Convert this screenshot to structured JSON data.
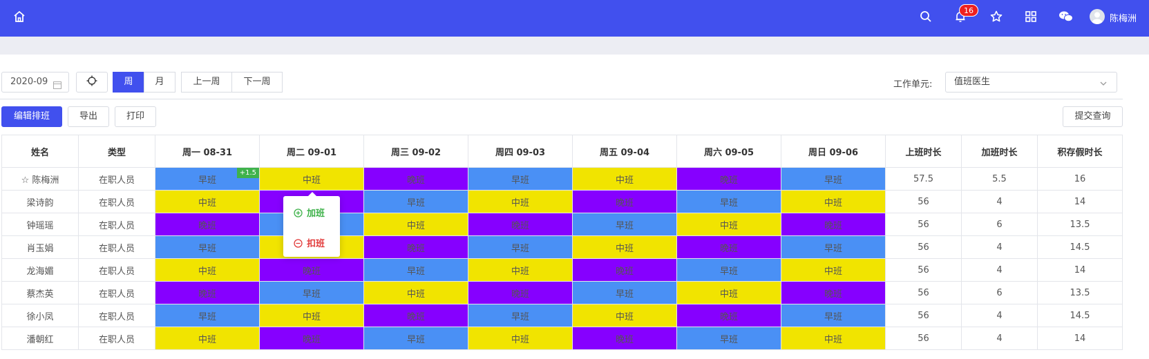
{
  "header": {
    "notifications": "16",
    "username": "陈梅洲"
  },
  "toolbar": {
    "month": "2020-09",
    "view_week": "周",
    "view_month": "月",
    "prev_week": "上一周",
    "next_week": "下一周",
    "work_unit_label": "工作单元:",
    "work_unit_value": "值班医生",
    "edit_schedule": "编辑排班",
    "export": "导出",
    "print": "打印",
    "submit_query": "提交查询"
  },
  "table": {
    "headers": [
      "姓名",
      "类型",
      "周一 08-31",
      "周二 09-01",
      "周三 09-02",
      "周四 09-03",
      "周五 09-04",
      "周六 09-05",
      "周日 09-06",
      "上班时长",
      "加班时长",
      "积存假时长"
    ],
    "rows": [
      {
        "name": "☆ 陈梅洲",
        "type": "在职人员",
        "shifts": [
          "早班",
          "中班",
          "晚班",
          "早班",
          "中班",
          "晚班",
          "早班"
        ],
        "work": "57.5",
        "overtime": "5.5",
        "leave": "16",
        "tag": "+1.5"
      },
      {
        "name": "梁诗韵",
        "type": "在职人员",
        "shifts": [
          "中班",
          "晚班",
          "早班",
          "中班",
          "晚班",
          "早班",
          "中班"
        ],
        "work": "56",
        "overtime": "4",
        "leave": "14"
      },
      {
        "name": "钟瑶瑶",
        "type": "在职人员",
        "shifts": [
          "晚班",
          "早班",
          "中班",
          "晚班",
          "早班",
          "中班",
          "晚班"
        ],
        "work": "56",
        "overtime": "6",
        "leave": "13.5"
      },
      {
        "name": "肖玉娟",
        "type": "在职人员",
        "shifts": [
          "早班",
          "中班",
          "晚班",
          "早班",
          "中班",
          "晚班",
          "早班"
        ],
        "work": "56",
        "overtime": "4",
        "leave": "14.5"
      },
      {
        "name": "龙海媚",
        "type": "在职人员",
        "shifts": [
          "中班",
          "晚班",
          "早班",
          "中班",
          "晚班",
          "早班",
          "中班"
        ],
        "work": "56",
        "overtime": "4",
        "leave": "14"
      },
      {
        "name": "蔡杰英",
        "type": "在职人员",
        "shifts": [
          "晚班",
          "早班",
          "中班",
          "晚班",
          "早班",
          "中班",
          "晚班"
        ],
        "work": "56",
        "overtime": "6",
        "leave": "13.5"
      },
      {
        "name": "徐小凤",
        "type": "在职人员",
        "shifts": [
          "早班",
          "中班",
          "晚班",
          "早班",
          "中班",
          "晚班",
          "早班"
        ],
        "work": "56",
        "overtime": "4",
        "leave": "14.5"
      },
      {
        "name": "潘朝红",
        "type": "在职人员",
        "shifts": [
          "中班",
          "晚班",
          "早班",
          "中班",
          "晚班",
          "早班",
          "中班"
        ],
        "work": "56",
        "overtime": "4",
        "leave": "14"
      }
    ]
  },
  "popup": {
    "add": "加班",
    "subtract": "扣班"
  },
  "colors": {
    "brand": "#4150ee",
    "early": "#4a90f5",
    "middle": "#f1e400",
    "night": "#8600ff",
    "overtime": "#3fb24b",
    "deduct": "#e23b3b"
  }
}
